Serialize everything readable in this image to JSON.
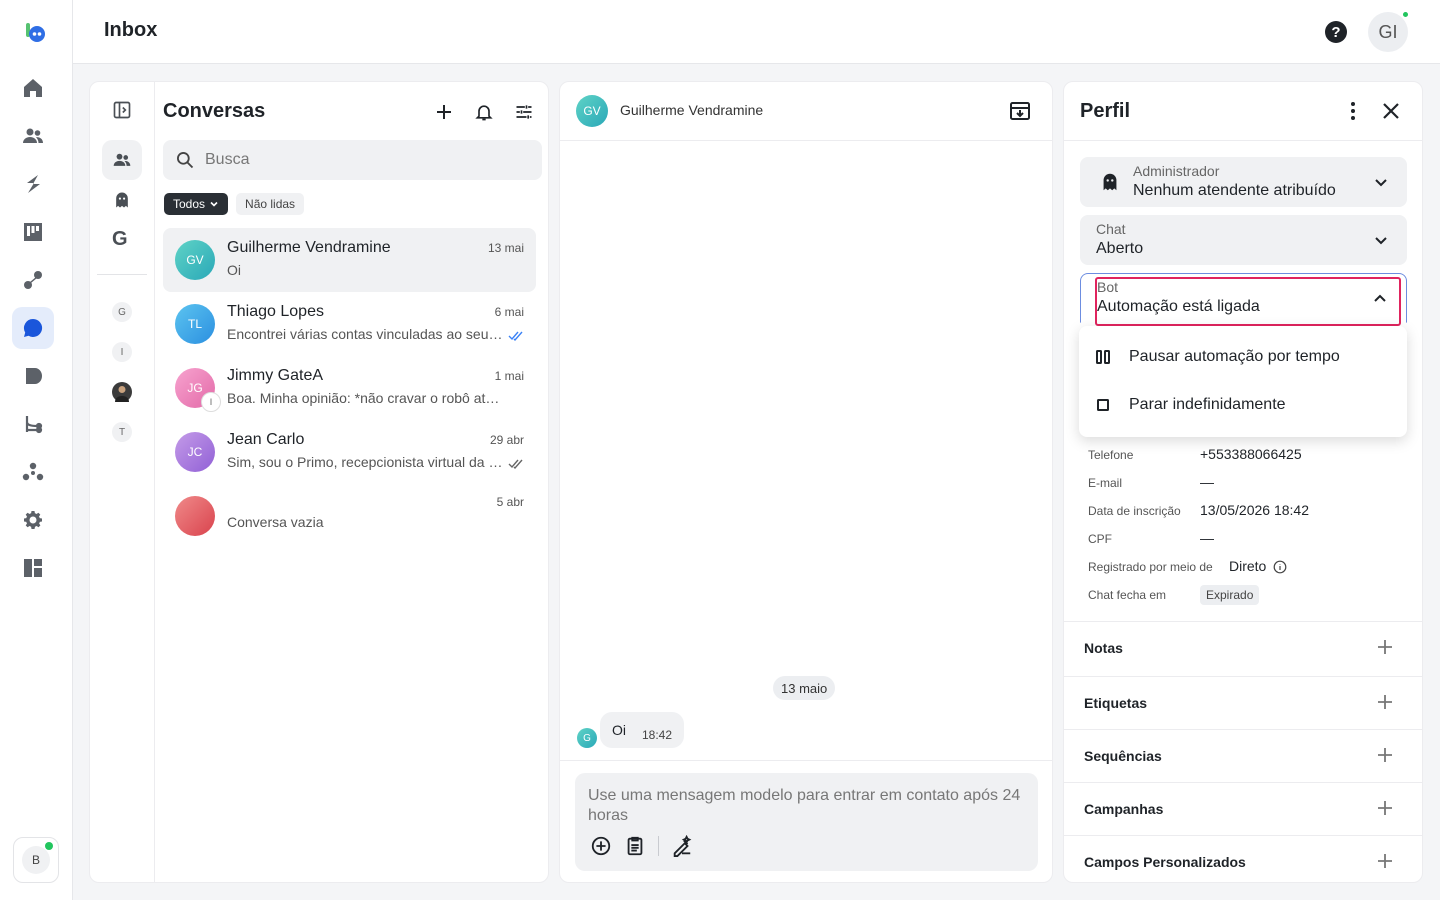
{
  "topbar": {
    "title": "Inbox",
    "help_label": "?",
    "avatar_initials": "GI"
  },
  "nav": {
    "items": [
      "home-icon",
      "contacts-icon",
      "zap-icon",
      "board-icon",
      "flow-icon",
      "chat-icon",
      "play-icon",
      "branches-icon",
      "network-icon",
      "settings-icon",
      "dashboard-icon"
    ],
    "active_item": "chat-icon",
    "user_badge": "B"
  },
  "rail": {
    "g_label": "G",
    "letters": [
      "G",
      "I",
      "T"
    ]
  },
  "conversations": {
    "title": "Conversas",
    "search_placeholder": "Busca",
    "filters": {
      "all": "Todos",
      "unread": "Não lidas"
    },
    "items": [
      {
        "initials": "GV",
        "name": "Guilherme Vendramine",
        "date": "13 mai",
        "preview": "Oi"
      },
      {
        "initials": "TL",
        "name": "Thiago Lopes",
        "date": "6 mai",
        "preview": "Encontrei várias contas vinculadas ao seu …"
      },
      {
        "initials": "JG",
        "badge": "I",
        "name": "Jimmy GateA",
        "date": "1 mai",
        "preview": "Boa. Minha opinião: *não cravar o robô atual c…"
      },
      {
        "initials": "JC",
        "name": "Jean Carlo",
        "date": "29 abr",
        "preview": "Sim, sou o Primo, recepcionista virtual da …"
      },
      {
        "initials": "",
        "name": "",
        "date": "5 abr",
        "preview": "Conversa vazia"
      }
    ]
  },
  "chat": {
    "header_initials": "GV",
    "header_name": "Guilherme Vendramine",
    "date_separator": "13 maio",
    "message_avatar": "G",
    "message_text": "Oi",
    "message_time": "18:42",
    "composer_placeholder": "Use uma mensagem modelo para entrar em contato após 24 horas"
  },
  "profile": {
    "title": "Perfil",
    "assignee": {
      "label": "Administrador",
      "value": "Nenhum atendente atribuído"
    },
    "chat_status": {
      "label": "Chat",
      "value": "Aberto"
    },
    "bot": {
      "label": "Bot",
      "value": "Automação está ligada"
    },
    "bot_menu": [
      "Pausar automação por tempo",
      "Parar indefinidamente"
    ],
    "fields": {
      "phone_label": "Telefone",
      "phone_value": "+553388066425",
      "email_label": "E-mail",
      "email_value": "—",
      "signup_label": "Data de inscrição",
      "signup_value": "13/05/2026 18:42",
      "cpf_label": "CPF",
      "cpf_value": "—",
      "registered_label": "Registrado por meio de",
      "registered_value": "Direto",
      "closes_label": "Chat fecha em",
      "closes_value": "Expirado"
    },
    "sections": [
      "Notas",
      "Etiquetas",
      "Sequências",
      "Campanhas",
      "Campos Personalizados"
    ]
  },
  "colors": {
    "accent": "#1a56db",
    "highlight": "#e0245e",
    "online": "#22c55e"
  }
}
